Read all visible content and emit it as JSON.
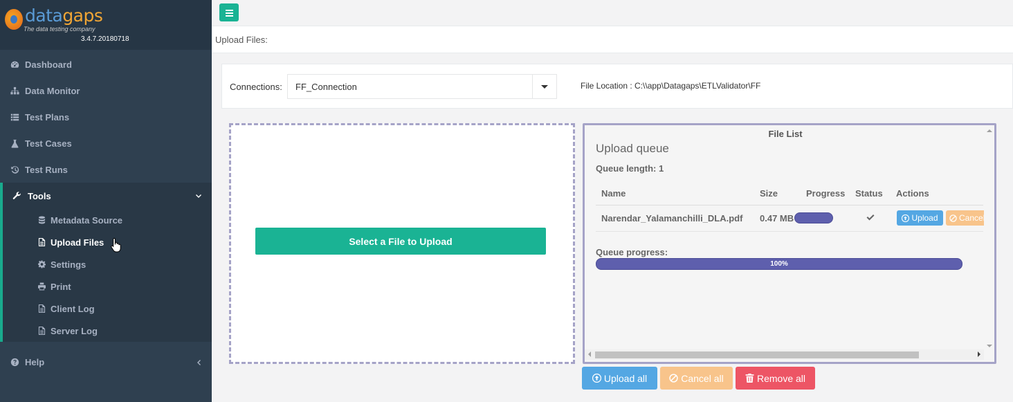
{
  "app": {
    "brand_main": "data",
    "brand_accent": "gaps",
    "tagline": "The data testing company",
    "version": "3.4.7.20180718"
  },
  "sidebar": {
    "items": [
      {
        "label": "Dashboard",
        "icon": "dashboard-icon"
      },
      {
        "label": "Data Monitor",
        "icon": "sitemap-icon"
      },
      {
        "label": "Test Plans",
        "icon": "list-icon"
      },
      {
        "label": "Test Cases",
        "icon": "flask-icon"
      },
      {
        "label": "Test Runs",
        "icon": "history-icon"
      }
    ],
    "tools": {
      "label": "Tools",
      "icon": "wrench-icon",
      "sub_items": [
        {
          "label": "Metadata Source",
          "icon": "database-icon"
        },
        {
          "label": "Upload Files",
          "icon": "file-icon",
          "active": true
        },
        {
          "label": "Settings",
          "icon": "gear-icon"
        },
        {
          "label": "Print",
          "icon": "print-icon"
        },
        {
          "label": "Client Log",
          "icon": "file-icon"
        },
        {
          "label": "Server Log",
          "icon": "file-icon"
        }
      ]
    },
    "help": {
      "label": "Help",
      "icon": "question-icon"
    }
  },
  "page": {
    "breadcrumb": "Upload Files:"
  },
  "connection": {
    "label": "Connections:",
    "selected": "FF_Connection",
    "file_location": "File Location : C:\\\\app\\Datagaps\\ETLValidator\\FF"
  },
  "dropzone": {
    "select_button": "Select a File to Upload"
  },
  "file_list": {
    "title": "File List",
    "queue_title": "Upload queue",
    "queue_length": "Queue length: 1",
    "columns": [
      "Name",
      "Size",
      "Progress",
      "Status",
      "Actions"
    ],
    "rows": [
      {
        "name": "Narendar_Yalamanchilli_DLA.pdf",
        "size": "0.47 MB",
        "progress": 100,
        "status": "check-icon",
        "upload_label": "Upload",
        "cancel_label": "Cancel"
      }
    ],
    "queue_progress_label": "Queue progress:",
    "queue_progress_value": "100%"
  },
  "bottom_buttons": {
    "upload_all": "Upload all",
    "cancel_all": "Cancel all",
    "remove_all": "Remove all"
  },
  "colors": {
    "sidebar_bg": "#2f4050",
    "accent_green": "#1ab394",
    "progress": "#5e5fad",
    "info": "#54a7e3",
    "warning": "#f8c48b",
    "danger": "#ed5565"
  }
}
